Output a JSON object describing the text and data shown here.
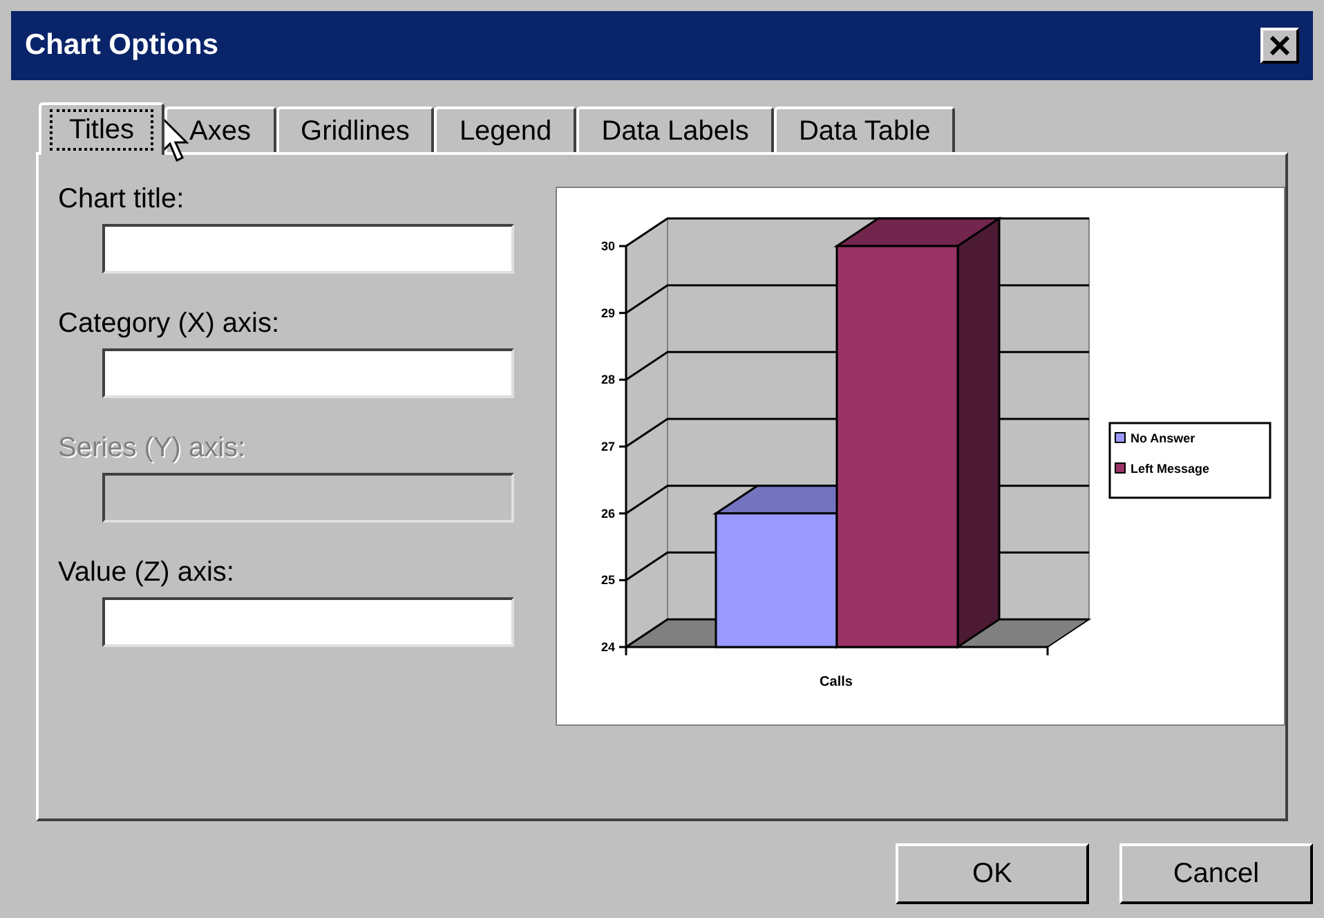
{
  "window": {
    "title": "Chart Options"
  },
  "tabs": [
    {
      "label": "Titles",
      "selected": true
    },
    {
      "label": "Axes",
      "selected": false
    },
    {
      "label": "Gridlines",
      "selected": false
    },
    {
      "label": "Legend",
      "selected": false
    },
    {
      "label": "Data Labels",
      "selected": false
    },
    {
      "label": "Data Table",
      "selected": false
    }
  ],
  "fields": [
    {
      "label": "Chart title:",
      "disabled": false
    },
    {
      "label": "Category (X) axis:",
      "disabled": false
    },
    {
      "label": "Series (Y) axis:",
      "disabled": true
    },
    {
      "label": "Value (Z) axis:",
      "disabled": false
    }
  ],
  "preview": {
    "chart_data": {
      "type": "bar",
      "categories": [
        "Calls"
      ],
      "series": [
        {
          "name": "No Answer",
          "color": "#9999ff",
          "values": [
            26
          ]
        },
        {
          "name": "Left Message",
          "color": "#993366",
          "values": [
            30
          ]
        }
      ],
      "legend": "right",
      "ylim": [
        24,
        30
      ],
      "yticks": [
        24,
        25,
        26,
        27,
        28,
        29,
        30
      ]
    }
  },
  "buttons": [
    "OK",
    "Cancel"
  ]
}
